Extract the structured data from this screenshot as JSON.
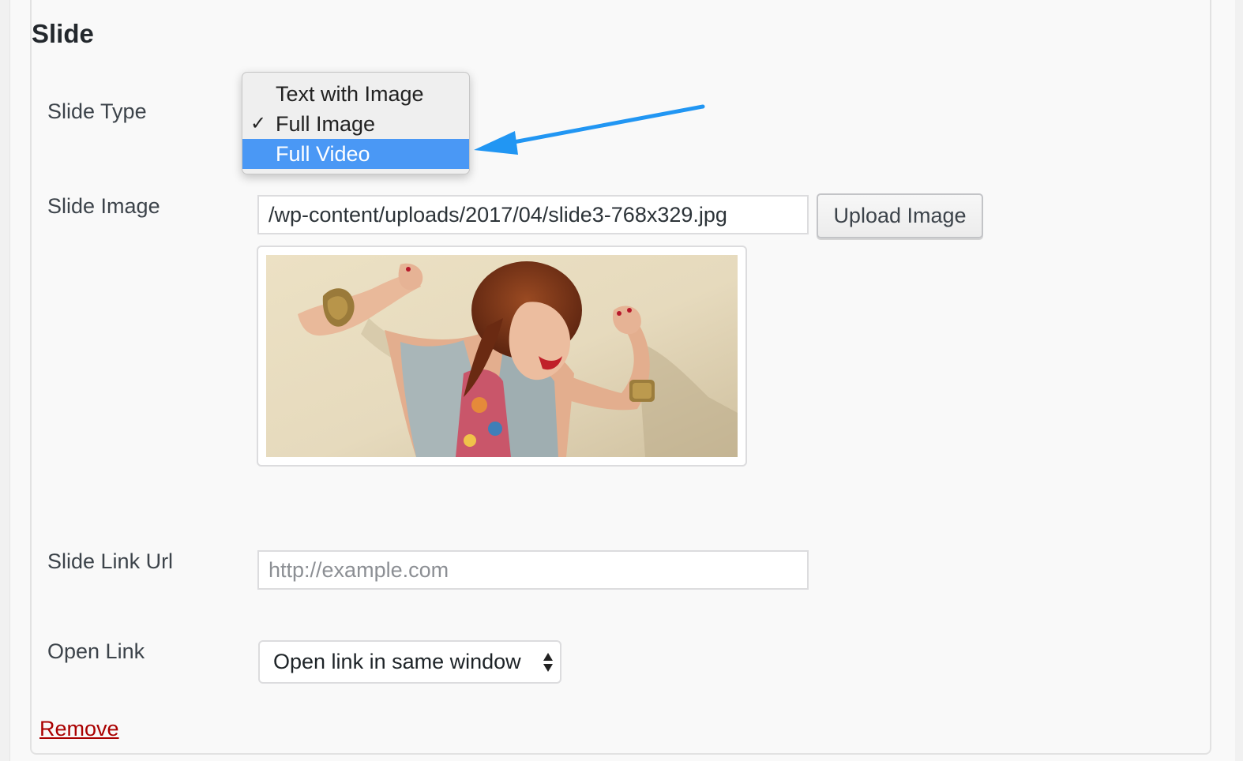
{
  "section": {
    "heading": "Slide"
  },
  "fields": {
    "slide_type": {
      "label": "Slide Type",
      "options": [
        {
          "label": "Text with Image",
          "checked": false,
          "highlighted": false
        },
        {
          "label": "Full Image",
          "checked": true,
          "highlighted": false
        },
        {
          "label": "Full Video",
          "checked": false,
          "highlighted": true
        }
      ],
      "check_glyph": "✓"
    },
    "slide_image": {
      "label": "Slide Image",
      "value": "/wp-content/uploads/2017/04/slide3-768x329.jpg",
      "upload_label": "Upload Image"
    },
    "slide_link_url": {
      "label": "Slide Link Url",
      "placeholder": "http://example.com",
      "value": ""
    },
    "open_link": {
      "label": "Open Link",
      "selected": "Open link in same window"
    }
  },
  "actions": {
    "remove_label": "Remove"
  },
  "icons": {
    "checkmark": "check-icon",
    "select_arrows": "select-arrows-icon",
    "annotation": "arrow-pointer-icon"
  },
  "colors": {
    "highlight": "#4a98f5",
    "annotation_arrow": "#2196f3",
    "remove_link": "#aa0000"
  }
}
